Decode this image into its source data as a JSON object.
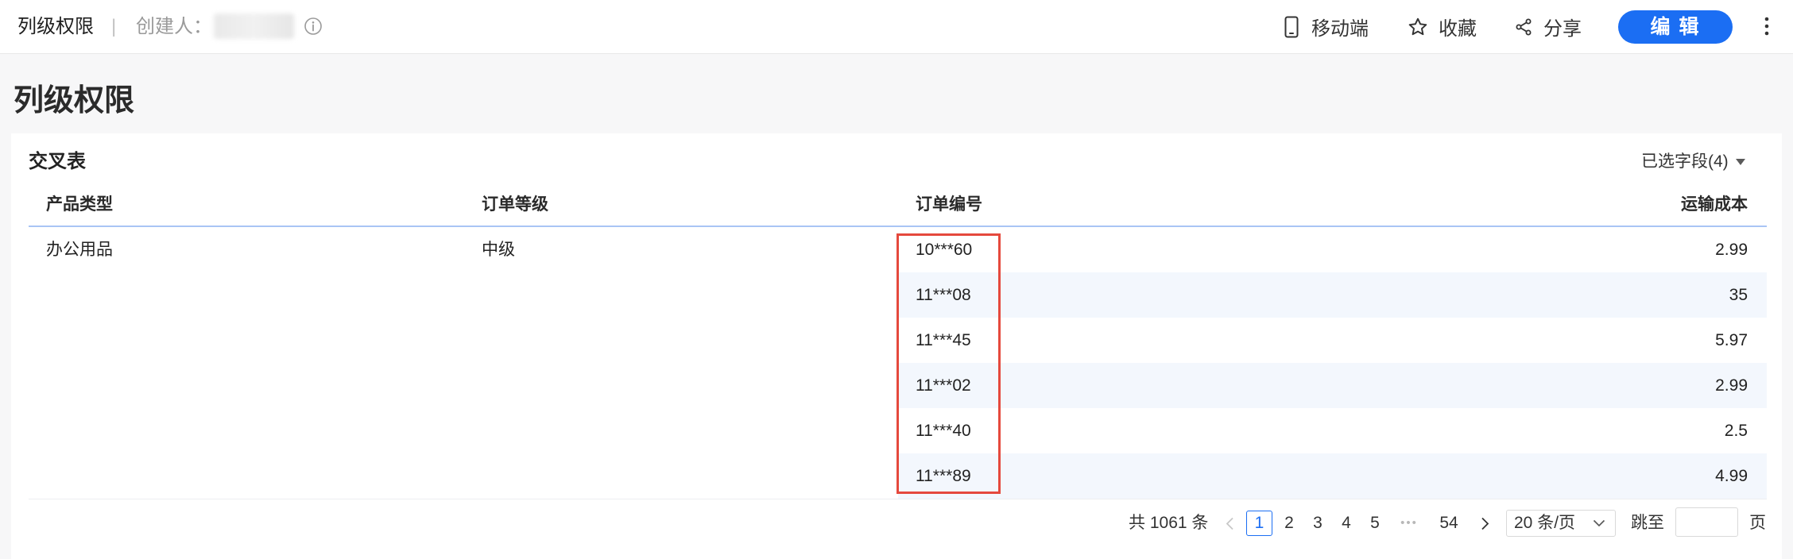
{
  "header": {
    "title": "列级权限",
    "separator": "|",
    "creator_label": "创建人：",
    "mobile_label": "移动端",
    "favorite_label": "收藏",
    "share_label": "分享",
    "edit_label": "编 辑"
  },
  "page": {
    "title": "列级权限"
  },
  "card": {
    "title": "交叉表",
    "field_selector_label": "已选字段(4)"
  },
  "table": {
    "columns": [
      "产品类型",
      "订单等级",
      "订单编号",
      "运输成本"
    ],
    "merged": {
      "product_type": "办公用品",
      "order_level": "中级"
    },
    "rows": [
      {
        "order_no": "10***60",
        "shipping_cost": "2.99"
      },
      {
        "order_no": "11***08",
        "shipping_cost": "35"
      },
      {
        "order_no": "11***45",
        "shipping_cost": "5.97"
      },
      {
        "order_no": "11***02",
        "shipping_cost": "2.99"
      },
      {
        "order_no": "11***40",
        "shipping_cost": "2.5"
      },
      {
        "order_no": "11***89",
        "shipping_cost": "4.99"
      }
    ]
  },
  "pagination": {
    "total": "共 1061 条",
    "pages": [
      "1",
      "2",
      "3",
      "4",
      "5",
      "54"
    ],
    "ellipsis": "•••",
    "page_size": "20 条/页",
    "jump_label": "跳至",
    "jump_value": "",
    "page_suffix": "页"
  },
  "colors": {
    "accent": "#1b6ef3",
    "highlight_border": "#e5493d",
    "row_stripe": "#f3f7fd",
    "header_divider": "#a9c5f5"
  },
  "icons": {
    "info": "info-circle-icon",
    "mobile": "mobile-phone-icon",
    "favorite": "star-icon",
    "share": "share-icon",
    "more": "more-vertical-icon",
    "field_selector": "caret-down-icon",
    "prev": "chevron-left-icon",
    "next": "chevron-right-icon",
    "select": "chevron-down-icon"
  }
}
